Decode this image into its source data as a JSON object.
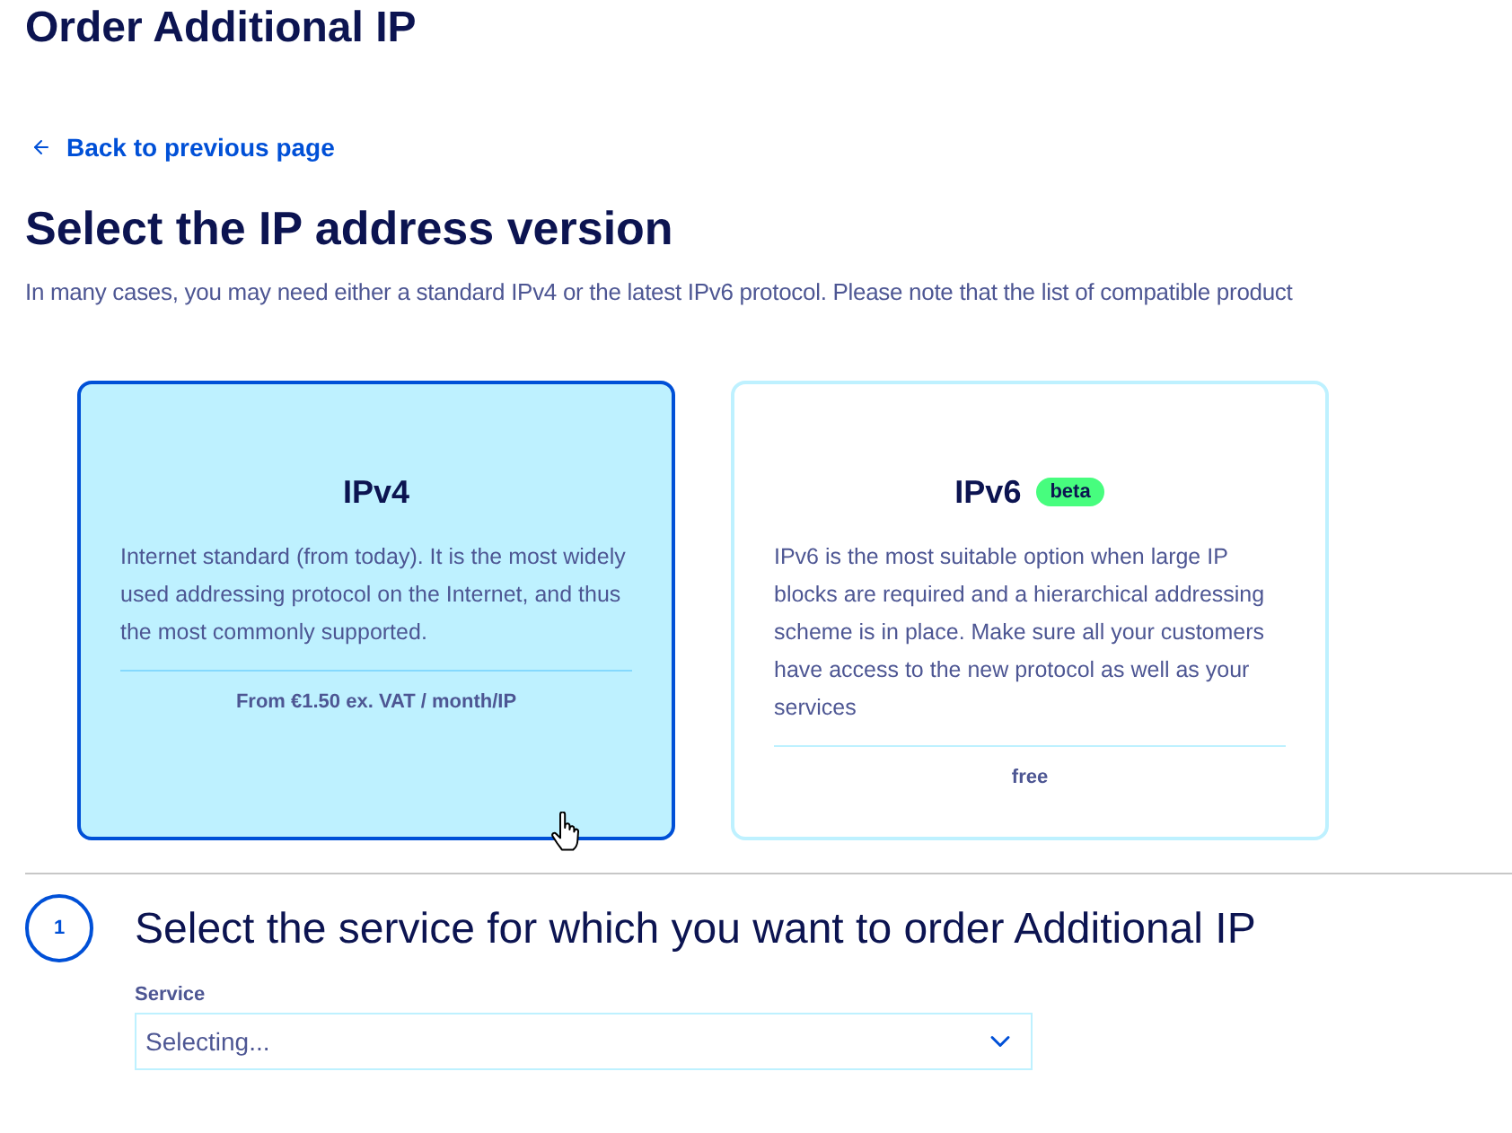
{
  "page_title": "Order Additional IP",
  "back_link": {
    "label": "Back to previous page"
  },
  "section": {
    "title": "Select the IP address version",
    "intro": "In many cases, you may need either a standard IPv4 or the latest IPv6 protocol. Please note that the list of compatible product"
  },
  "versions": [
    {
      "name": "IPv4",
      "selected": true,
      "description": "Internet standard (from today). It is the most widely used addressing protocol on the Internet, and thus the most commonly supported.",
      "price": "From €1.50 ex. VAT / month/IP"
    },
    {
      "name": "IPv6",
      "selected": false,
      "badge": "beta",
      "description": "IPv6 is the most suitable option when large IP blocks are required and a hierarchical addressing scheme is in place. Make sure all your customers have access to the new protocol as well as your services",
      "price": "free"
    }
  ],
  "step": {
    "number": "1",
    "title": "Select the service for which you want to order Additional IP",
    "field": {
      "label": "Service",
      "value": "Selecting..."
    }
  }
}
